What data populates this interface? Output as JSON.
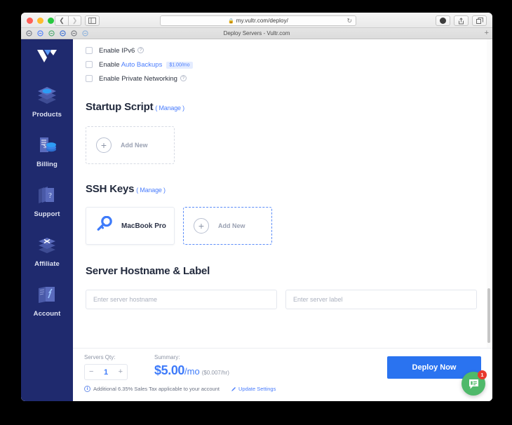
{
  "browser": {
    "url": "my.vultr.com/deploy/",
    "lock_icon": "lock-icon",
    "reload_icon": "reload-icon",
    "back_icon": "chevron-left-icon",
    "forward_icon": "chevron-right-icon",
    "sidebar_icon": "sidebar-toggle-icon",
    "share_icon": "share-icon",
    "tabs_icon": "tabs-overview-icon",
    "reader_icon": "reader-mode-icon",
    "tab_title": "Deploy Servers - Vultr.com",
    "new_tab_label": "+",
    "bookmarks": [
      {
        "name": "bookmark-favicon-1",
        "color": "#6f7480"
      },
      {
        "name": "bookmark-favicon-2",
        "color": "#4a7dfd"
      },
      {
        "name": "bookmark-favicon-3",
        "color": "#4aa86f"
      },
      {
        "name": "bookmark-favicon-4",
        "color": "#3b6fd4"
      },
      {
        "name": "bookmark-favicon-5",
        "color": "#77797f"
      },
      {
        "name": "bookmark-favicon-6",
        "color": "#8fb3dd"
      }
    ]
  },
  "sidebar": {
    "logo": "vultr-logo",
    "items": [
      {
        "label": "Products",
        "icon": "layers-icon"
      },
      {
        "label": "Billing",
        "icon": "invoice-coins-icon"
      },
      {
        "label": "Support",
        "icon": "support-ticket-icon"
      },
      {
        "label": "Affiliate",
        "icon": "affiliate-link-icon"
      },
      {
        "label": "Account",
        "icon": "account-folder-icon"
      }
    ]
  },
  "options": {
    "items": [
      {
        "prefix": "Enable IPv6",
        "link": "",
        "has_help": true,
        "badge": ""
      },
      {
        "prefix": "Enable ",
        "link": "Auto Backups",
        "has_help": false,
        "badge": "$1.00/mo"
      },
      {
        "prefix": "Enable Private Networking",
        "link": "",
        "has_help": true,
        "badge": ""
      }
    ]
  },
  "startup_script": {
    "title": "Startup Script",
    "manage": "( Manage )",
    "add_new_label": "Add New",
    "plus_icon": "plus-circle-icon"
  },
  "ssh_keys": {
    "title": "SSH Keys",
    "manage": "( Manage )",
    "key_name": "MacBook Pro",
    "key_icon": "key-icon",
    "add_new_label": "Add New",
    "plus_icon": "plus-circle-icon"
  },
  "hostname": {
    "title": "Server Hostname & Label",
    "hostname_placeholder": "Enter server hostname",
    "label_placeholder": "Enter server label"
  },
  "footer": {
    "qty_caption": "Servers Qty:",
    "qty_value": "1",
    "decrement": "−",
    "increment": "+",
    "summary_caption": "Summary:",
    "price_amount": "$5.00",
    "price_period": "/mo",
    "price_hourly": "($0.007/hr)",
    "deploy_label": "Deploy Now",
    "tax_note": "Additional 6.35% Sales Tax applicable to your account",
    "update_settings": "Update Settings",
    "info_icon": "info-icon",
    "pencil_icon": "pencil-icon"
  },
  "chat": {
    "icon": "chat-bubble-icon",
    "badge": "1"
  },
  "colors": {
    "sidebar_bg": "#1f2a6e",
    "accent_blue": "#2a73f0",
    "link_blue": "#4a7dfd",
    "chat_green": "#4fb96a",
    "badge_red": "#e8392d"
  }
}
